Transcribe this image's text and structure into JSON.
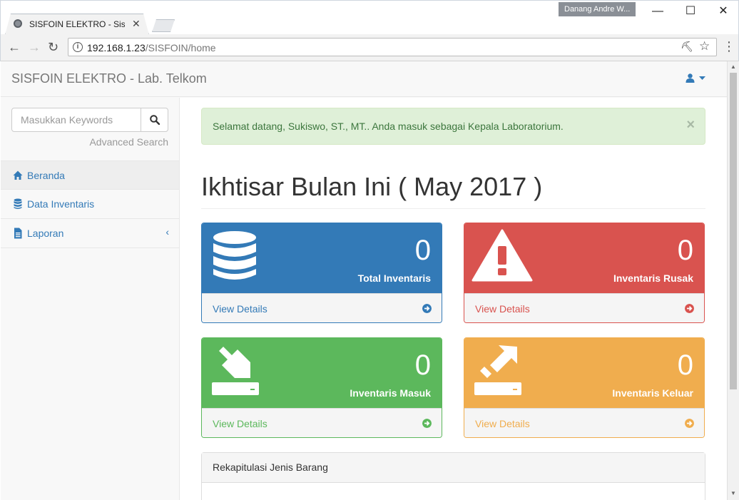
{
  "browser": {
    "tab_title": "SISFOIN ELEKTRO - Sistem",
    "profile_name": "Danang Andre W...",
    "url_host": "192.168.1.23",
    "url_path": "/SISFOIN/home",
    "icons": [
      "back-icon",
      "forward-icon",
      "reload-icon",
      "info-icon",
      "key-icon",
      "star-icon",
      "menu-icon"
    ]
  },
  "navbar": {
    "brand": "SISFOIN ELEKTRO - Lab. Telkom",
    "user_icon": "user-icon"
  },
  "sidebar": {
    "search_placeholder": "Masukkan Keywords",
    "advanced_search": "Advanced Search",
    "items": [
      {
        "label": "Beranda",
        "icon": "home-icon",
        "active": true
      },
      {
        "label": "Data Inventaris",
        "icon": "database-icon",
        "active": false
      },
      {
        "label": "Laporan",
        "icon": "file-icon",
        "active": false
      }
    ],
    "collapse_glyph": "‹"
  },
  "alert": {
    "message": "Selamat datang, Sukiswo, ST., MT.. Anda masuk sebagai Kepala Laboratorium.",
    "close": "×"
  },
  "main": {
    "title": "Ikhtisar Bulan Ini ( May 2017 )",
    "panels": [
      {
        "label": "Total Inventaris",
        "value": "0",
        "link": "View Details",
        "color": "#337ab7",
        "icon": "database-icon"
      },
      {
        "label": "Inventaris Rusak",
        "value": "0",
        "link": "View Details",
        "color": "#d9534f",
        "icon": "warning-icon"
      },
      {
        "label": "Inventaris Masuk",
        "value": "0",
        "link": "View Details",
        "color": "#5cb85c",
        "icon": "download-icon"
      },
      {
        "label": "Inventaris Keluar",
        "value": "0",
        "link": "View Details",
        "color": "#f0ad4e",
        "icon": "upload-icon"
      }
    ],
    "rekap_title": "Rekapitulasi Jenis Barang"
  }
}
